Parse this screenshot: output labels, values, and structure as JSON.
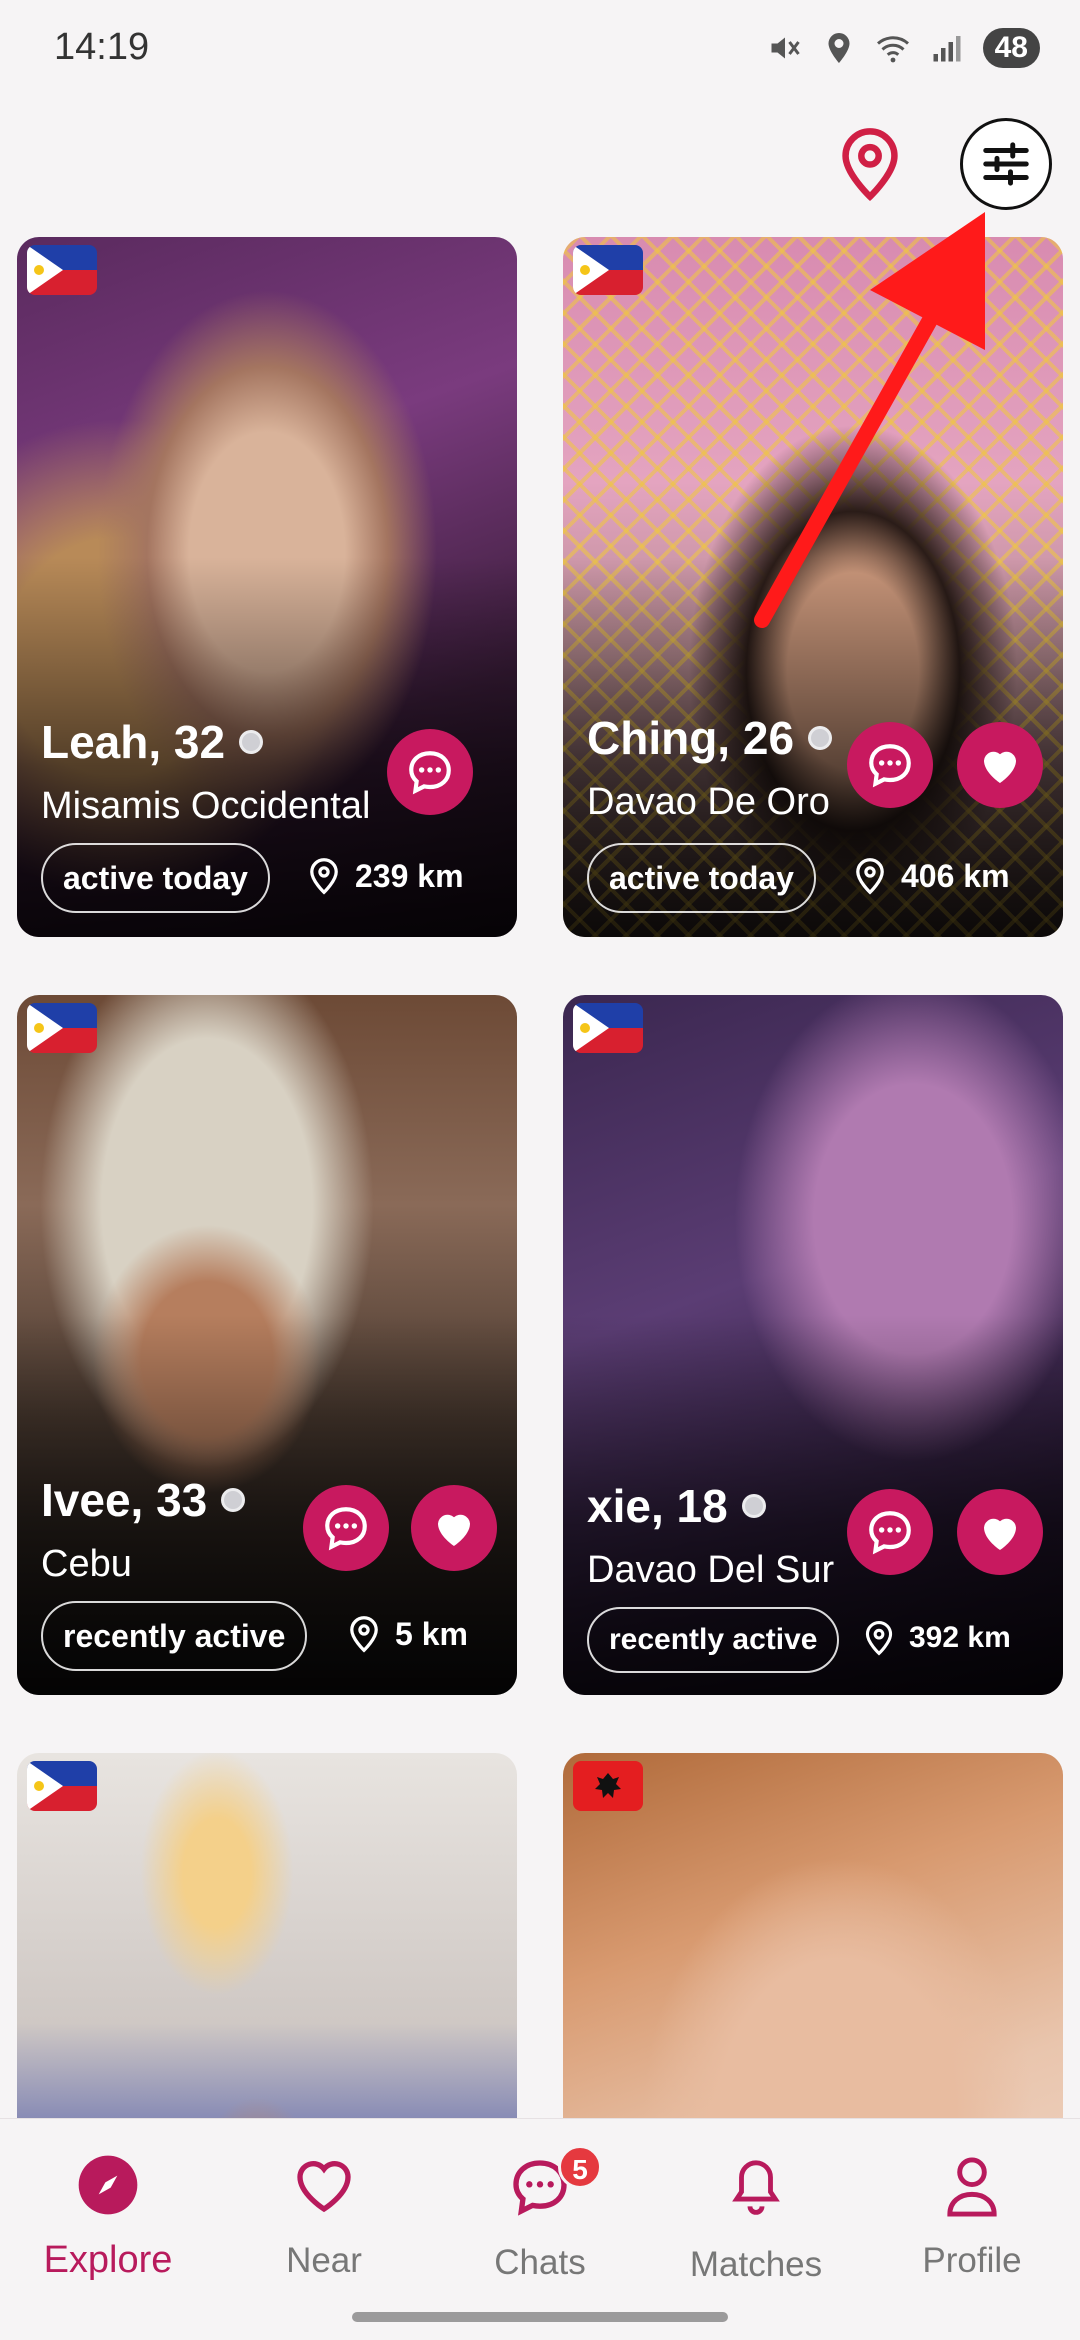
{
  "status_bar": {
    "time": "14:19",
    "battery": "48"
  },
  "top_actions": {
    "location_icon": "location-pin-icon",
    "filter_icon": "sliders-icon"
  },
  "colors": {
    "accent": "#c8195f",
    "nav_active": "#b81a5c",
    "badge": "#e5393f"
  },
  "profiles": [
    {
      "name_age": "Leah, 32",
      "region": "Misamis Occidental",
      "activity": "active today",
      "distance": "239 km",
      "flag": "Philippines",
      "show_like": false
    },
    {
      "name_age": "Ching, 26",
      "region": "Davao De Oro",
      "activity": "active today",
      "distance": "406 km",
      "flag": "Philippines",
      "show_like": true
    },
    {
      "name_age": "Ivee, 33",
      "region": "Cebu",
      "activity": "recently active",
      "distance": "5 km",
      "flag": "Philippines",
      "show_like": true
    },
    {
      "name_age": "xie, 18",
      "region": "Davao Del Sur",
      "activity": "recently active",
      "distance": "392 km",
      "flag": "Philippines",
      "show_like": true
    },
    {
      "flag": "Philippines"
    },
    {
      "flag": "Albania"
    }
  ],
  "nav": [
    {
      "label": "Explore",
      "icon": "compass-icon",
      "active": true
    },
    {
      "label": "Near",
      "icon": "heart-icon",
      "active": false
    },
    {
      "label": "Chats",
      "icon": "chat-bubble-icon",
      "active": false,
      "badge": "5"
    },
    {
      "label": "Matches",
      "icon": "bell-icon",
      "active": false
    },
    {
      "label": "Profile",
      "icon": "person-icon",
      "active": false
    }
  ]
}
